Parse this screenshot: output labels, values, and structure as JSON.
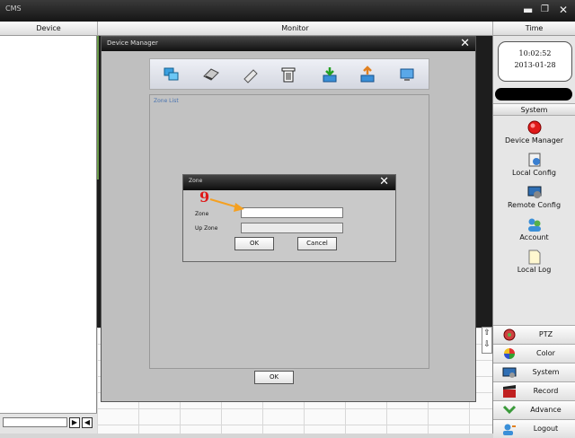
{
  "app": {
    "title": "CMS"
  },
  "columns": {
    "device": "Device",
    "monitor": "Monitor",
    "time": "Time"
  },
  "clock": {
    "time": "10:02:52",
    "date": "2013-01-28"
  },
  "device_manager": {
    "title": "Device Manager",
    "toolbar": [
      "add-device-icon",
      "edit-device-icon",
      "connect-icon",
      "delete-icon",
      "import-icon",
      "export-icon",
      "cloud-device-icon"
    ],
    "zone_list_label": "Zone List",
    "ok": "OK"
  },
  "zone_dialog": {
    "title": "Zone",
    "zone_label": "Zone",
    "zone_value": "",
    "up_zone_label": "Up Zone",
    "up_zone_value": "",
    "ok": "OK",
    "cancel": "Cancel"
  },
  "annotation": {
    "step": "9",
    "color": "#e01818",
    "arrow_color": "#f5a020"
  },
  "system_panel": {
    "header": "System",
    "items": [
      "Device Manager",
      "Local Config",
      "Remote Config",
      "Account",
      "Local Log"
    ]
  },
  "right_buttons": [
    "PTZ",
    "Color",
    "System",
    "Record",
    "Advance",
    "Logout"
  ]
}
